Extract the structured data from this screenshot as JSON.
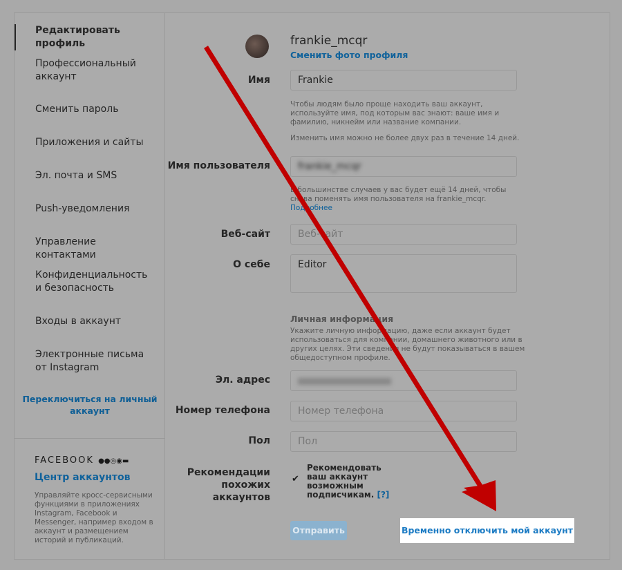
{
  "sidebar": {
    "items": [
      "Редактировать профиль",
      "Профессиональный аккаунт",
      "Сменить пароль",
      "Приложения и сайты",
      "Эл. почта и SMS",
      "Push-уведомления",
      "Управление контактами",
      "Конфиденциальность и безопасность",
      "Входы в аккаунт",
      "Электронные письма от Instagram"
    ],
    "switch_link": "Переключиться на личный аккаунт",
    "facebook_label": "FACEBOOK",
    "accounts_center": "Центр аккаунтов",
    "accounts_center_desc": "Управляйте кросс-сервисными функциями в приложениях Instagram, Facebook и Messenger, например входом в аккаунт и размещением историй и публикаций."
  },
  "profile": {
    "username": "frankie_mcqr",
    "change_photo": "Сменить фото профиля"
  },
  "form": {
    "name_label": "Имя",
    "name_value": "Frankie",
    "name_help1": "Чтобы людям было проще находить ваш аккаунт, используйте имя, под которым вас знают: ваше имя и фамилию, никнейм или название компании.",
    "name_help2": "Изменить имя можно не более двух раз в течение 14 дней.",
    "username_label": "Имя пользователя",
    "username_value": "frankie_mcqr",
    "username_help": "В большинстве случаев у вас будет ещё 14 дней, чтобы снова поменять имя пользователя на frankie_mcqr.",
    "more_link": "Подробнее",
    "website_label": "Веб-сайт",
    "website_placeholder": "Веб-сайт",
    "bio_label": "О себе",
    "bio_value": "Editor",
    "personal_title": "Личная информация",
    "personal_help": "Укажите личную информацию, даже если аккаунт будет использоваться для компании, домашнего животного или в других целях. Эти сведения не будут показываться в вашем общедоступном профиле.",
    "email_label": "Эл. адрес",
    "phone_label": "Номер телефона",
    "phone_placeholder": "Номер телефона",
    "gender_label": "Пол",
    "gender_placeholder": "Пол",
    "recs_label": "Рекомендации похожих аккаунтов",
    "recs_text": "Рекомендовать ваш аккаунт возможным подписчикам.",
    "recs_help": "[?]",
    "recs_checked": true,
    "submit": "Отправить",
    "deactivate": "Временно отключить мой аккаунт"
  },
  "colors": {
    "link": "#10629b",
    "arrow": "#c00000",
    "overlay": "#a9a9a9"
  }
}
